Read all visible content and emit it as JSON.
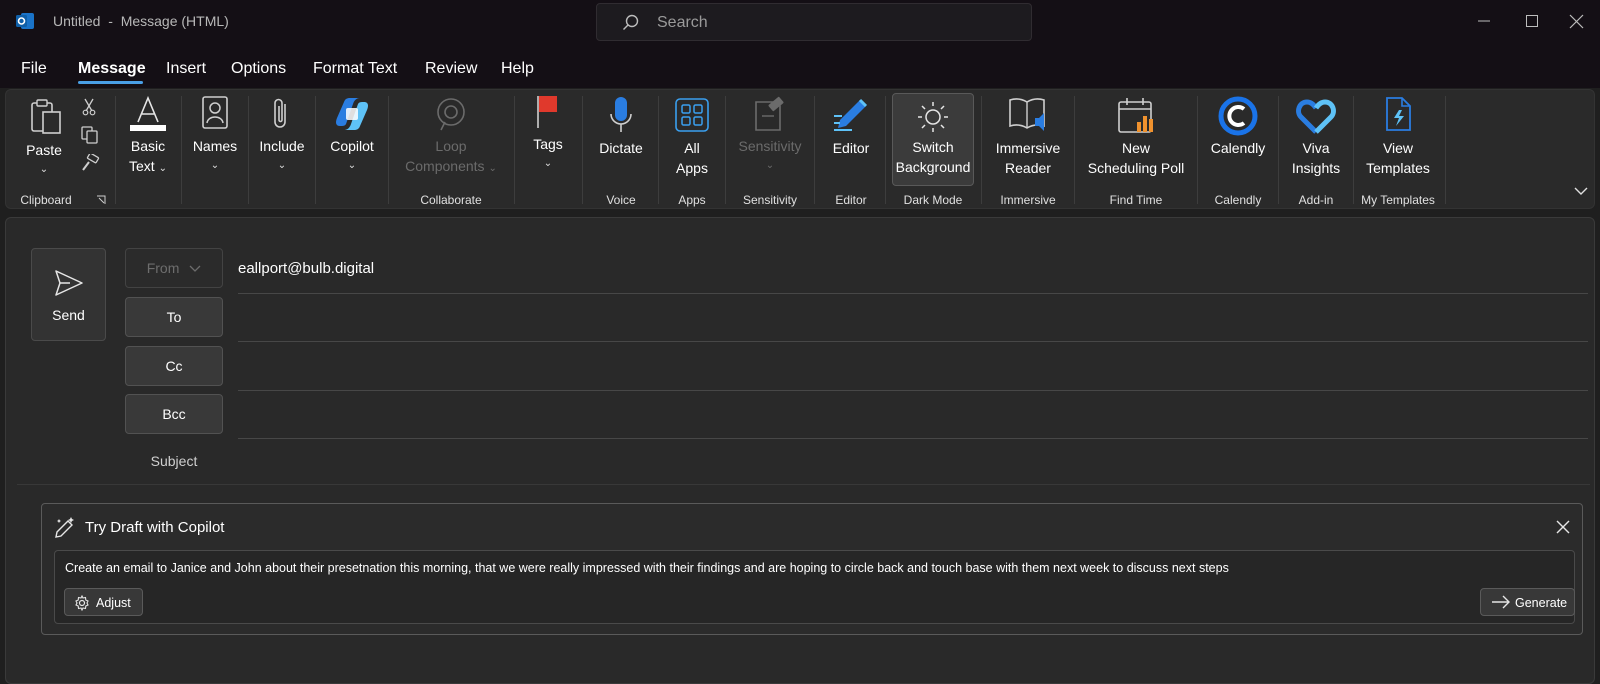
{
  "window": {
    "title": "Untitled  -  Message (HTML)",
    "search_placeholder": "Search"
  },
  "menu": {
    "tabs": [
      "File",
      "Message",
      "Insert",
      "Options",
      "Format Text",
      "Review",
      "Help"
    ],
    "active_tab": "Message"
  },
  "ribbon": {
    "paste": "Paste",
    "basic_text_1": "Basic",
    "basic_text_2": "Text",
    "names": "Names",
    "include": "Include",
    "copilot": "Copilot",
    "loop_1": "Loop",
    "loop_2": "Components",
    "tags": "Tags",
    "dictate": "Dictate",
    "all_apps_1": "All",
    "all_apps_2": "Apps",
    "sensitivity": "Sensitivity",
    "editor": "Editor",
    "switch_bg_1": "Switch",
    "switch_bg_2": "Background",
    "immersive_1": "Immersive",
    "immersive_2": "Reader",
    "scheduling_1": "New",
    "scheduling_2": "Scheduling Poll",
    "calendly": "Calendly",
    "viva_1": "Viva",
    "viva_2": "Insights",
    "templates_1": "View",
    "templates_2": "Templates",
    "groups": {
      "clipboard": "Clipboard",
      "collaborate": "Collaborate",
      "voice": "Voice",
      "apps": "Apps",
      "sensitivity": "Sensitivity",
      "editor": "Editor",
      "dark_mode": "Dark Mode",
      "immersive": "Immersive",
      "find_time": "Find Time",
      "calendly": "Calendly",
      "add_in": "Add-in",
      "my_templates": "My Templates"
    }
  },
  "compose": {
    "send": "Send",
    "from_label": "From",
    "from_value": "eallport@bulb.digital",
    "to_label": "To",
    "cc_label": "Cc",
    "bcc_label": "Bcc",
    "subject_label": "Subject"
  },
  "copilot_panel": {
    "title": "Try Draft with Copilot",
    "prompt": "Create an email to Janice and John about their presetnation this morning, that we were really impressed with their findings and are hoping to circle back and touch base with them next week to discuss next steps",
    "adjust": "Adjust",
    "generate": "Generate"
  },
  "colors": {
    "accent": "#4aa0e6",
    "titlebar": "#140f15",
    "ribbon": "#2a2a2a",
    "compose": "#292929"
  }
}
